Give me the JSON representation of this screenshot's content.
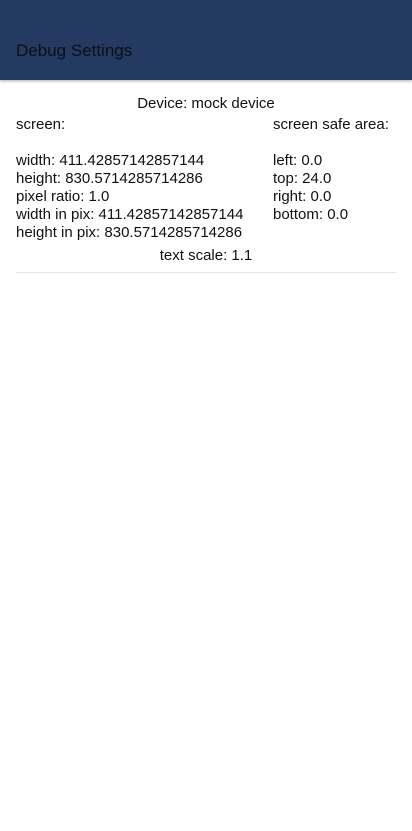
{
  "app_bar": {
    "title": "Debug Settings",
    "background_color": "#243a60"
  },
  "device": {
    "label": "Device: mock device"
  },
  "screen": {
    "header": "screen:",
    "rows": [
      "width: 411.42857142857144",
      "height: 830.5714285714286",
      "pixel ratio: 1.0",
      "width in pix: 411.42857142857144",
      "height in pix: 830.5714285714286"
    ]
  },
  "safe_area": {
    "header": "screen safe area:",
    "rows": [
      "left: 0.0",
      "top: 24.0",
      "right: 0.0",
      "bottom: 0.0"
    ]
  },
  "text_scale": {
    "label": "text scale: 1.1"
  }
}
